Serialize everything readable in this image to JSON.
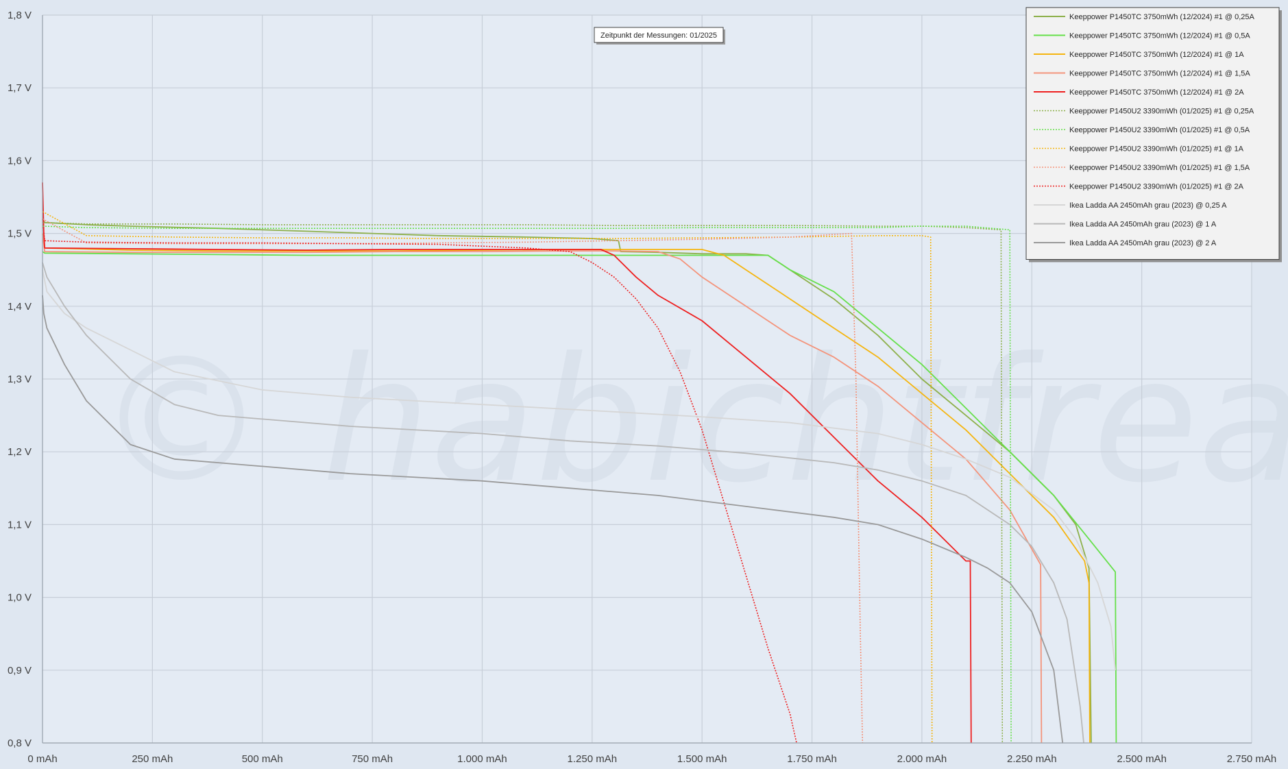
{
  "chart_data": {
    "type": "line",
    "title": "",
    "xlabel": "",
    "ylabel": "",
    "xlim": [
      0,
      2750
    ],
    "ylim": [
      0.8,
      1.8
    ],
    "grid": true,
    "legend_position": "top-right",
    "x_ticks": [
      {
        "value": 0,
        "label": "0 mAh"
      },
      {
        "value": 250,
        "label": "250 mAh"
      },
      {
        "value": 500,
        "label": "500 mAh"
      },
      {
        "value": 750,
        "label": "750 mAh"
      },
      {
        "value": 1000,
        "label": "1.000 mAh"
      },
      {
        "value": 1250,
        "label": "1.250 mAh"
      },
      {
        "value": 1500,
        "label": "1.500 mAh"
      },
      {
        "value": 1750,
        "label": "1.750 mAh"
      },
      {
        "value": 2000,
        "label": "2.000 mAh"
      },
      {
        "value": 2250,
        "label": "2.250 mAh"
      },
      {
        "value": 2500,
        "label": "2.500 mAh"
      },
      {
        "value": 2750,
        "label": "2.750 mAh"
      }
    ],
    "y_ticks": [
      {
        "value": 0.8,
        "label": "0,8 V"
      },
      {
        "value": 0.9,
        "label": "0,9 V"
      },
      {
        "value": 1.0,
        "label": "1,0 V"
      },
      {
        "value": 1.1,
        "label": "1,1 V"
      },
      {
        "value": 1.2,
        "label": "1,2 V"
      },
      {
        "value": 1.3,
        "label": "1,3 V"
      },
      {
        "value": 1.4,
        "label": "1,4 V"
      },
      {
        "value": 1.5,
        "label": "1,5 V"
      },
      {
        "value": 1.6,
        "label": "1,6 V"
      },
      {
        "value": 1.7,
        "label": "1,7 V"
      },
      {
        "value": 1.8,
        "label": "1,8 V"
      }
    ],
    "annotations": [
      {
        "text": "Zeitpunkt der Messungen: 01/2025",
        "x": 1500,
        "y": 1.77
      }
    ],
    "watermark": "© habichtfreak",
    "series": [
      {
        "name": "Keeppower P1450TC 3750mWh (12/2024) #1 @ 0,25A",
        "color": "#8db04a",
        "dash": "solid",
        "x": [
          0,
          5,
          100,
          200,
          400,
          600,
          750,
          900,
          1100,
          1250,
          1310,
          1315,
          1400,
          1500,
          1600,
          1650,
          1700,
          1800,
          1900,
          2000,
          2100,
          2200,
          2300,
          2350,
          2380,
          2385
        ],
        "y": [
          1.52,
          1.515,
          1.512,
          1.51,
          1.507,
          1.503,
          1.5,
          1.497,
          1.495,
          1.493,
          1.49,
          1.475,
          1.474,
          1.472,
          1.472,
          1.47,
          1.45,
          1.41,
          1.36,
          1.3,
          1.25,
          1.2,
          1.14,
          1.1,
          1.04,
          0.8
        ]
      },
      {
        "name": "Keeppower P1450TC 3750mWh (12/2024) #1 @ 0,5A",
        "color": "#66e04a",
        "dash": "solid",
        "x": [
          0,
          5,
          200,
          400,
          600,
          800,
          1000,
          1200,
          1400,
          1500,
          1600,
          1650,
          1700,
          1800,
          1900,
          2000,
          2100,
          2200,
          2300,
          2380,
          2440,
          2442
        ],
        "y": [
          1.475,
          1.473,
          1.472,
          1.471,
          1.47,
          1.47,
          1.47,
          1.47,
          1.47,
          1.47,
          1.47,
          1.47,
          1.45,
          1.42,
          1.37,
          1.32,
          1.26,
          1.2,
          1.14,
          1.08,
          1.035,
          0.8
        ]
      },
      {
        "name": "Keeppower P1450TC 3750mWh (12/2024) #1 @ 1A",
        "color": "#f5b50f",
        "dash": "solid",
        "x": [
          0,
          5,
          200,
          400,
          600,
          800,
          1000,
          1200,
          1300,
          1400,
          1500,
          1550,
          1600,
          1700,
          1800,
          1900,
          2000,
          2100,
          2200,
          2300,
          2370,
          2380,
          2382
        ],
        "y": [
          1.5,
          1.48,
          1.477,
          1.476,
          1.476,
          1.476,
          1.477,
          1.478,
          1.478,
          1.478,
          1.478,
          1.47,
          1.45,
          1.41,
          1.37,
          1.33,
          1.28,
          1.23,
          1.17,
          1.11,
          1.05,
          1.02,
          0.8
        ]
      },
      {
        "name": "Keeppower P1450TC 3750mWh (12/2024) #1 @ 1,5A",
        "color": "#f4937a",
        "dash": "solid",
        "x": [
          0,
          5,
          200,
          400,
          600,
          800,
          1000,
          1200,
          1300,
          1400,
          1450,
          1500,
          1600,
          1700,
          1800,
          1900,
          2000,
          2100,
          2200,
          2270,
          2272
        ],
        "y": [
          1.5,
          1.475,
          1.474,
          1.474,
          1.474,
          1.475,
          1.475,
          1.476,
          1.476,
          1.475,
          1.465,
          1.44,
          1.4,
          1.36,
          1.33,
          1.29,
          1.24,
          1.19,
          1.12,
          1.045,
          0.8
        ]
      },
      {
        "name": "Keeppower P1450TC 3750mWh (12/2024) #1 @ 2A",
        "color": "#ee1f1f",
        "dash": "solid",
        "x": [
          0,
          3,
          5,
          200,
          400,
          600,
          800,
          1000,
          1200,
          1270,
          1300,
          1350,
          1400,
          1500,
          1600,
          1700,
          1800,
          1900,
          2000,
          2100,
          2110,
          2112
        ],
        "y": [
          1.57,
          1.5,
          1.48,
          1.479,
          1.478,
          1.477,
          1.478,
          1.478,
          1.478,
          1.478,
          1.47,
          1.44,
          1.415,
          1.38,
          1.33,
          1.28,
          1.22,
          1.16,
          1.11,
          1.05,
          1.05,
          0.8
        ]
      },
      {
        "name": "Keeppower P1450U2 3390mWh (01/2025) #1 @ 0,25A",
        "color": "#8db04a",
        "dash": "dotted",
        "x": [
          0,
          100,
          300,
          500,
          700,
          900,
          1100,
          1300,
          1500,
          1700,
          1900,
          2000,
          2100,
          2180,
          2183
        ],
        "y": [
          1.515,
          1.513,
          1.513,
          1.512,
          1.512,
          1.512,
          1.512,
          1.511,
          1.511,
          1.511,
          1.51,
          1.51,
          1.508,
          1.505,
          0.8
        ]
      },
      {
        "name": "Keeppower P1450U2 3390mWh (01/2025) #1 @ 0,5A",
        "color": "#66e04a",
        "dash": "dotted",
        "x": [
          0,
          100,
          300,
          500,
          700,
          900,
          1100,
          1300,
          1500,
          1700,
          1900,
          2000,
          2100,
          2200,
          2203
        ],
        "y": [
          1.51,
          1.508,
          1.507,
          1.507,
          1.507,
          1.507,
          1.507,
          1.507,
          1.508,
          1.508,
          1.508,
          1.51,
          1.51,
          1.505,
          0.8
        ]
      },
      {
        "name": "Keeppower P1450U2 3390mWh (01/2025) #1 @ 1A",
        "color": "#f5b50f",
        "dash": "dotted",
        "x": [
          0,
          100,
          300,
          500,
          700,
          900,
          1100,
          1300,
          1500,
          1700,
          1900,
          2000,
          2020,
          2023
        ],
        "y": [
          1.53,
          1.497,
          1.495,
          1.494,
          1.494,
          1.493,
          1.493,
          1.493,
          1.494,
          1.495,
          1.497,
          1.497,
          1.495,
          0.8
        ]
      },
      {
        "name": "Keeppower P1450U2 3390mWh (01/2025) #1 @ 1,5A",
        "color": "#f4937a",
        "dash": "dotted",
        "x": [
          0,
          100,
          300,
          500,
          700,
          900,
          1100,
          1300,
          1500,
          1700,
          1840,
          1850,
          1860,
          1865
        ],
        "y": [
          1.52,
          1.487,
          1.486,
          1.486,
          1.486,
          1.487,
          1.488,
          1.49,
          1.492,
          1.495,
          1.5,
          1.3,
          0.95,
          0.8
        ]
      },
      {
        "name": "Keeppower P1450U2 3390mWh (01/2025) #1 @ 2A",
        "color": "#ee1f1f",
        "dash": "dotted",
        "x": [
          0,
          5,
          100,
          300,
          500,
          700,
          900,
          1100,
          1200,
          1250,
          1300,
          1350,
          1400,
          1450,
          1500,
          1550,
          1600,
          1650,
          1700,
          1715
        ],
        "y": [
          1.52,
          1.49,
          1.488,
          1.487,
          1.487,
          1.486,
          1.485,
          1.48,
          1.475,
          1.46,
          1.44,
          1.41,
          1.37,
          1.31,
          1.23,
          1.13,
          1.03,
          0.93,
          0.84,
          0.8
        ]
      },
      {
        "name": "Ikea Ladda AA 2450mAh grau (2023) @ 0,25 A",
        "color": "#d6d6d6",
        "dash": "solid",
        "x": [
          0,
          10,
          50,
          100,
          200,
          300,
          500,
          700,
          1000,
          1300,
          1500,
          1700,
          1900,
          2000,
          2100,
          2200,
          2300,
          2350,
          2400,
          2430,
          2440
        ],
        "y": [
          1.45,
          1.42,
          1.39,
          1.37,
          1.34,
          1.31,
          1.285,
          1.275,
          1.265,
          1.255,
          1.248,
          1.24,
          1.225,
          1.21,
          1.19,
          1.165,
          1.12,
          1.08,
          1.02,
          0.96,
          0.9
        ]
      },
      {
        "name": "Ikea Ladda AA 2450mAh grau (2023) @ 1 A",
        "color": "#b8b8b8",
        "dash": "solid",
        "x": [
          0,
          10,
          50,
          100,
          200,
          300,
          400,
          500,
          700,
          1000,
          1200,
          1400,
          1600,
          1800,
          1900,
          2000,
          2100,
          2200,
          2250,
          2300,
          2330,
          2360,
          2368
        ],
        "y": [
          1.46,
          1.44,
          1.4,
          1.36,
          1.3,
          1.265,
          1.25,
          1.245,
          1.235,
          1.225,
          1.215,
          1.208,
          1.198,
          1.185,
          1.175,
          1.16,
          1.14,
          1.1,
          1.07,
          1.02,
          0.97,
          0.85,
          0.8
        ]
      },
      {
        "name": "Ikea Ladda AA 2450mAh grau (2023) @ 2 A",
        "color": "#999999",
        "dash": "solid",
        "x": [
          0,
          3,
          10,
          50,
          100,
          200,
          300,
          400,
          500,
          700,
          1000,
          1200,
          1400,
          1600,
          1800,
          1900,
          2000,
          2100,
          2150,
          2200,
          2250,
          2300,
          2310,
          2320
        ],
        "y": [
          1.415,
          1.39,
          1.37,
          1.32,
          1.27,
          1.21,
          1.19,
          1.185,
          1.18,
          1.17,
          1.16,
          1.15,
          1.14,
          1.125,
          1.11,
          1.1,
          1.08,
          1.055,
          1.04,
          1.02,
          0.98,
          0.9,
          0.85,
          0.8
        ]
      }
    ]
  }
}
